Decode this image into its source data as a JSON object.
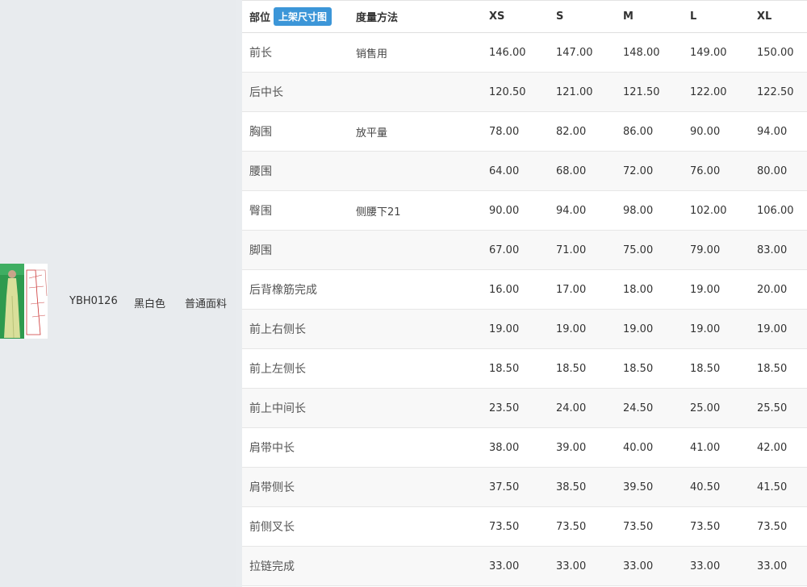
{
  "product": {
    "sku": "YBH0126",
    "color": "黑白色",
    "fabric": "普通面料",
    "thumbnail_icon": "dress-sketch-thumbnail"
  },
  "table": {
    "headers": {
      "part": "部位",
      "upload_button": "上架尺寸图",
      "method": "度量方法",
      "sizes": [
        "XS",
        "S",
        "M",
        "L",
        "XL"
      ]
    },
    "rows": [
      {
        "part": "前长",
        "method": "销售用",
        "values": [
          "146.00",
          "147.00",
          "148.00",
          "149.00",
          "150.00"
        ]
      },
      {
        "part": "后中长",
        "method": "",
        "values": [
          "120.50",
          "121.00",
          "121.50",
          "122.00",
          "122.50"
        ]
      },
      {
        "part": "胸围",
        "method": "放平量",
        "values": [
          "78.00",
          "82.00",
          "86.00",
          "90.00",
          "94.00"
        ]
      },
      {
        "part": "腰围",
        "method": "",
        "values": [
          "64.00",
          "68.00",
          "72.00",
          "76.00",
          "80.00"
        ]
      },
      {
        "part": "臀围",
        "method": "侧腰下21",
        "values": [
          "90.00",
          "94.00",
          "98.00",
          "102.00",
          "106.00"
        ]
      },
      {
        "part": "脚围",
        "method": "",
        "values": [
          "67.00",
          "71.00",
          "75.00",
          "79.00",
          "83.00"
        ]
      },
      {
        "part": "后背橡筋完成",
        "method": "",
        "values": [
          "16.00",
          "17.00",
          "18.00",
          "19.00",
          "20.00"
        ]
      },
      {
        "part": "前上右侧长",
        "method": "",
        "values": [
          "19.00",
          "19.00",
          "19.00",
          "19.00",
          "19.00"
        ]
      },
      {
        "part": "前上左侧长",
        "method": "",
        "values": [
          "18.50",
          "18.50",
          "18.50",
          "18.50",
          "18.50"
        ]
      },
      {
        "part": "前上中间长",
        "method": "",
        "values": [
          "23.50",
          "24.00",
          "24.50",
          "25.00",
          "25.50"
        ]
      },
      {
        "part": "肩带中长",
        "method": "",
        "values": [
          "38.00",
          "39.00",
          "40.00",
          "41.00",
          "42.00"
        ]
      },
      {
        "part": "肩带侧长",
        "method": "",
        "values": [
          "37.50",
          "38.50",
          "39.50",
          "40.50",
          "41.50"
        ]
      },
      {
        "part": "前侧叉长",
        "method": "",
        "values": [
          "73.50",
          "73.50",
          "73.50",
          "73.50",
          "73.50"
        ]
      },
      {
        "part": "拉链完成",
        "method": "",
        "values": [
          "33.00",
          "33.00",
          "33.00",
          "33.00",
          "33.00"
        ]
      }
    ]
  },
  "colors": {
    "page_background": "#e8ebee",
    "table_background": "#ffffff",
    "stripe": "#f8f8f8",
    "button": "#3c96d8",
    "thumbnail_green": "#2e9a4e"
  }
}
